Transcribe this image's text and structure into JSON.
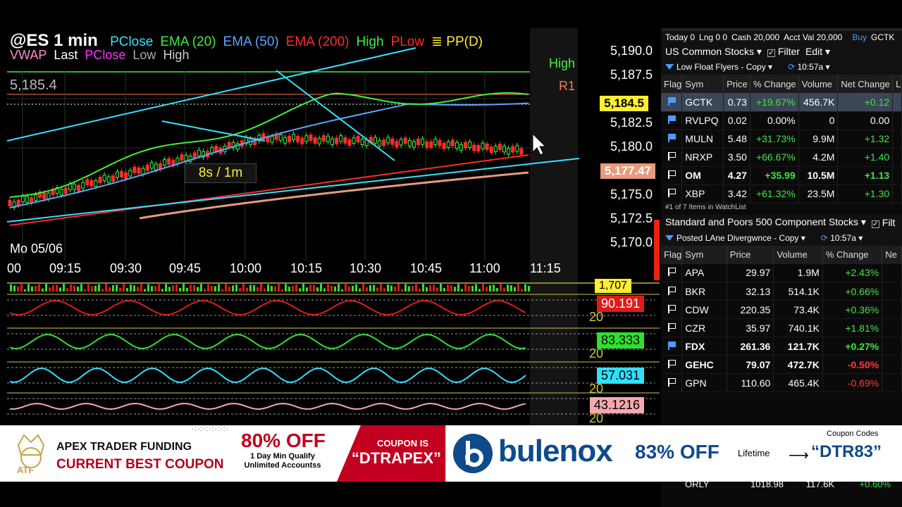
{
  "chart": {
    "symbol": "@ES 1 min",
    "legend1": [
      {
        "label": "PClose",
        "color": "#37e0ff"
      },
      {
        "label": "EMA (20)",
        "color": "#3ff03f"
      },
      {
        "label": "EMA (50)",
        "color": "#5aa7ff"
      },
      {
        "label": "EMA (200)",
        "color": "#ff2a2a"
      },
      {
        "label": "High",
        "color": "#3ff03f"
      },
      {
        "label": "PLow",
        "color": "#ff2a2a"
      },
      {
        "label": "≣ PP(D)",
        "color": "#ffee33"
      }
    ],
    "legend2": [
      {
        "label": "VWAP",
        "color": "#ff8ad0"
      },
      {
        "label": "Last",
        "color": "#ffffff"
      },
      {
        "label": "PClose",
        "color": "#ff30ff"
      },
      {
        "label": "Low",
        "color": "#aaaaaa"
      },
      {
        "label": "High",
        "color": "#cccccc"
      }
    ],
    "left_price": "5,185.4",
    "price_axis": [
      "5,190.0",
      "5,187.5",
      "5,182.5",
      "5,180.0",
      "5,175.0",
      "5,172.5",
      "5,170.0"
    ],
    "high_tag": "High",
    "r1_tag": "R1",
    "last_price": "5,184.5",
    "ema200_price": "5,177.47",
    "timer": "8s / 1m",
    "date_label": "Mo 05/06",
    "time_axis": [
      "00",
      "09:15",
      "09:30",
      "09:45",
      "10:00",
      "10:15",
      "10:30",
      "10:45",
      "11:00",
      "11:15"
    ],
    "volume_value": "1,707",
    "osc_values": [
      "90.191",
      "83.333",
      "57.031",
      "43.1216"
    ],
    "osc_level": "20"
  },
  "account_bar": {
    "today": "Today 0",
    "lng": "Lng 0 0",
    "cash": "Cash 20,000",
    "acct_val": "Acct Val 20,000",
    "buy": "Buy",
    "symbol": "GCTK"
  },
  "watchlist1": {
    "title": "US Common Stocks ▾",
    "filter": "Filter",
    "edit": "Edit ▾",
    "sub": "Low Float Flyers - Copy ▾",
    "time": "10:57a ▾",
    "columns": [
      "Flag",
      "Sym",
      "Price",
      "% Change",
      "Volume",
      "Net Change",
      "L"
    ],
    "rows": [
      {
        "sym": "GCTK",
        "price": "0.73",
        "pct": "+19.67%",
        "vol": "456.7K",
        "net": "+0.12",
        "flag": true,
        "dir": "pos",
        "sel": true
      },
      {
        "sym": "RVLPQ",
        "price": "0.02",
        "pct": "0.00%",
        "vol": "0",
        "net": "0.00",
        "flag": true,
        "dir": "",
        "sel": false
      },
      {
        "sym": "MULN",
        "price": "5.48",
        "pct": "+31.73%",
        "vol": "9.9M",
        "net": "+1.32",
        "flag": true,
        "dir": "pos",
        "sel": false
      },
      {
        "sym": "NRXP",
        "price": "3.50",
        "pct": "+66.67%",
        "vol": "4.2M",
        "net": "+1.40",
        "flag": false,
        "dir": "pos",
        "sel": false
      },
      {
        "sym": "OM",
        "price": "4.27",
        "pct": "+35.99",
        "vol": "10.5M",
        "net": "+1.13",
        "flag": false,
        "dir": "pos",
        "sel": false,
        "bold": true
      },
      {
        "sym": "XBP",
        "price": "3.42",
        "pct": "+61.32%",
        "vol": "23.5M",
        "net": "+1.30",
        "flag": false,
        "dir": "pos",
        "sel": false
      }
    ],
    "status": "#1 of 7 Items in WatchList"
  },
  "watchlist2": {
    "title": "Standard and Poors 500 Component Stocks ▾",
    "filter": "Filt",
    "sub": "Posted LAne Divergwnce - Copy ▾",
    "time": "10:57a ▾",
    "columns": [
      "Flag",
      "Sym",
      "Price",
      "Volume",
      "% Change",
      "Ne"
    ],
    "rows": [
      {
        "sym": "APA",
        "price": "29.97",
        "vol": "1.9M",
        "pct": "+2.43%",
        "flag": false,
        "dir": "pos"
      },
      {
        "sym": "BKR",
        "price": "32.13",
        "vol": "514.1K",
        "pct": "+0.66%",
        "flag": false,
        "dir": "pos"
      },
      {
        "sym": "CDW",
        "price": "220.35",
        "vol": "73.4K",
        "pct": "+0.36%",
        "flag": false,
        "dir": "pos"
      },
      {
        "sym": "CZR",
        "price": "35.97",
        "vol": "740.1K",
        "pct": "+1.81%",
        "flag": false,
        "dir": "pos"
      },
      {
        "sym": "FDX",
        "price": "261.36",
        "vol": "121.7K",
        "pct": "+0.27%",
        "flag": true,
        "dir": "pos",
        "bold": true
      },
      {
        "sym": "GEHC",
        "price": "79.07",
        "vol": "472.7K",
        "pct": "-0.50%",
        "flag": false,
        "dir": "neg",
        "bold": true
      },
      {
        "sym": "GPN",
        "price": "110.60",
        "vol": "465.4K",
        "pct": "-0.69%",
        "flag": false,
        "dir": "neg"
      }
    ],
    "last_row": {
      "sym": "ORLY",
      "price": "1018.98",
      "vol": "117.6K",
      "pct": "+0.60%"
    }
  },
  "banner": {
    "apex_line1": "APEX TRADER FUNDING",
    "apex_line2": "CURRENT BEST COUPON",
    "atf": "ATF",
    "off80": "80% OFF",
    "qualify_line1": "1 Day Min Qualify",
    "qualify_line2": "Unlimited Accountss",
    "coupon_is": "COUPON IS",
    "coupon_code": "“DTRAPEX”",
    "bulenox": "bulenox",
    "off83": "83% OFF",
    "lifetime": "Lifetime",
    "coupon_codes": "Coupon Codes",
    "bulenox_code": "“DTR83”"
  }
}
